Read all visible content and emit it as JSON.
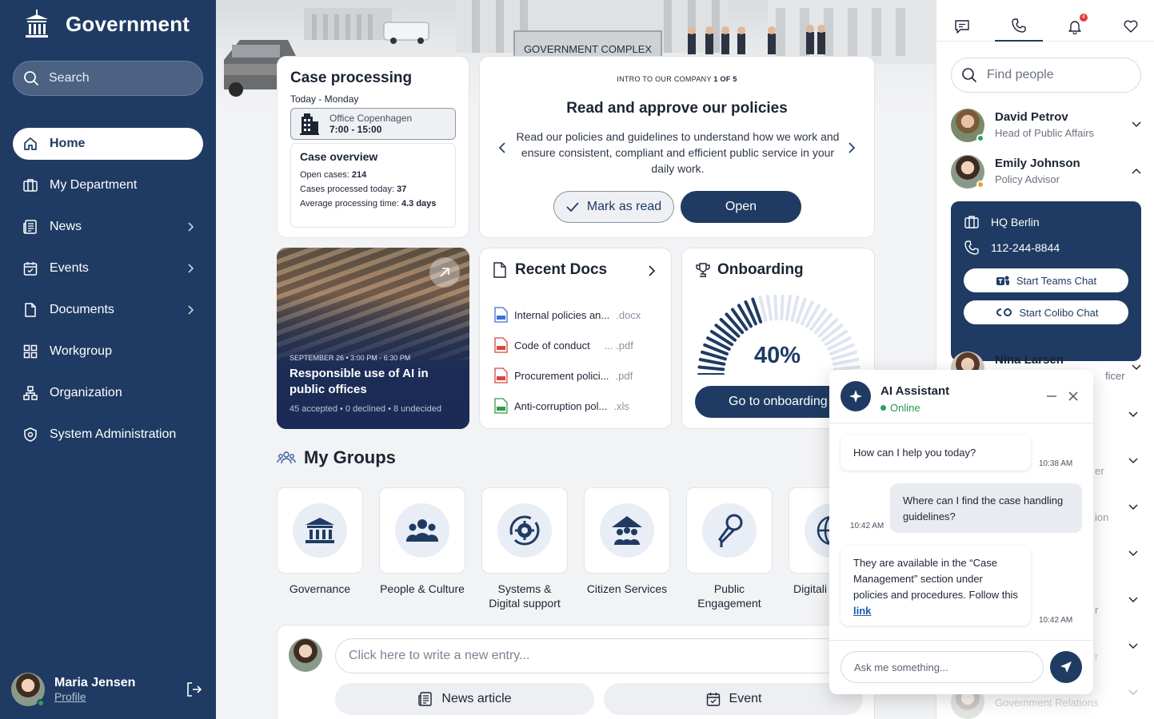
{
  "sidebar": {
    "brand": "Government",
    "search_label": "Search",
    "nav": [
      {
        "label": "Home",
        "active": true
      },
      {
        "label": "My Department"
      },
      {
        "label": "News",
        "expandable": true
      },
      {
        "label": "Events",
        "expandable": true
      },
      {
        "label": "Documents",
        "expandable": true
      },
      {
        "label": "Workgroup"
      },
      {
        "label": "Organization"
      },
      {
        "label": "System Administration"
      }
    ],
    "user": {
      "name": "Maria Jensen",
      "profile_link": "Profile",
      "status": "online"
    }
  },
  "hero": {
    "sign": "GOVERNMENT COMPLEX"
  },
  "case_processing": {
    "title": "Case processing",
    "date": "Today - Monday",
    "office_name": "Office Copenhagen",
    "office_hours": "7:00 - 15:00",
    "overview_title": "Case overview",
    "open_cases_label": "Open cases: ",
    "open_cases": "214",
    "processed_label": "Cases processed today: ",
    "processed": "37",
    "avg_label": "Average processing time: ",
    "avg": "4.3 days"
  },
  "policy": {
    "kicker": "INTRO TO OUR COMPANY ",
    "kicker_page": "1 OF 5",
    "title": "Read and approve our policies",
    "body": "Read our policies and guidelines to understand how we work and ensure consistent, compliant and efficient public service in your daily work.",
    "mark_label": "Mark as read",
    "open_label": "Open"
  },
  "event": {
    "date": "SEPTEMBER 26 • 3:00 PM - 6:30 PM",
    "title": "Responsible use of AI in public offices",
    "stats": "45 accepted • 0 declined • 8 undecided"
  },
  "recent_docs": {
    "title": "Recent Docs",
    "items": [
      {
        "name": "Internal policies an...",
        "ext": ".docx",
        "icon": "word-doc-icon"
      },
      {
        "name": "Code of conduct",
        "ext": "... .pdf",
        "icon": "pdf-doc-icon"
      },
      {
        "name": "Procurement polici...",
        "ext": ".pdf",
        "icon": "pdf-doc-icon"
      },
      {
        "name": "Anti-corruption pol...",
        "ext": ".xls",
        "icon": "excel-doc-icon"
      }
    ]
  },
  "onboarding": {
    "title": "Onboarding",
    "progress": 0.4,
    "progress_label": "40%",
    "button": "Go to onboarding"
  },
  "groups": {
    "title": "My Groups",
    "items": [
      {
        "name": "Governance",
        "icon": "bank-icon"
      },
      {
        "name": "People & Culture",
        "icon": "people-icon"
      },
      {
        "name": "Systems & Digital support",
        "icon": "gear-refresh-icon"
      },
      {
        "name": "Citizen Services",
        "icon": "citizen-house-icon"
      },
      {
        "name": "Public Engagement",
        "icon": "microphone-icon"
      },
      {
        "name": "Digitali",
        "icon": "globe-icon"
      }
    ]
  },
  "composer": {
    "placeholder": "Click here to write a new entry...",
    "news_button": "News article",
    "event_button": "Event"
  },
  "right_panel": {
    "notification_count": "4",
    "find_placeholder": "Find people",
    "people": [
      {
        "name": "David Petrov",
        "role": "Head of Public Affairs",
        "status": "online"
      },
      {
        "name": "Emily Johnson",
        "role": "Policy Advisor",
        "status": "away",
        "expanded": true
      },
      {
        "name": "Nina Larsen",
        "role_fragment": "ficer"
      }
    ],
    "contact": {
      "location": "HQ Berlin",
      "phone": "112-244-8844",
      "teams_button": "Start Teams Chat",
      "colibo_button": "Start Colibo Chat"
    },
    "hidden_fragments": [
      "er",
      "ion",
      "r",
      "r",
      "Government Relations"
    ]
  },
  "ai": {
    "title": "AI Assistant",
    "status": "Online",
    "messages": [
      {
        "from": "bot",
        "text": "How can I help you today?",
        "time": "10:38 AM"
      },
      {
        "from": "user",
        "text": "Where can I find the case handling guidelines?",
        "time": "10:42 AM"
      },
      {
        "from": "bot",
        "text": "They are available in the “Case Management” section under policies and procedures. Follow this ",
        "link": "link",
        "time": "10:42 AM"
      }
    ],
    "input_placeholder": "Ask me something..."
  },
  "colors": {
    "navy": "#1f3b63",
    "online": "#27a356",
    "away": "#f0a020",
    "badge": "#e23b3b"
  }
}
